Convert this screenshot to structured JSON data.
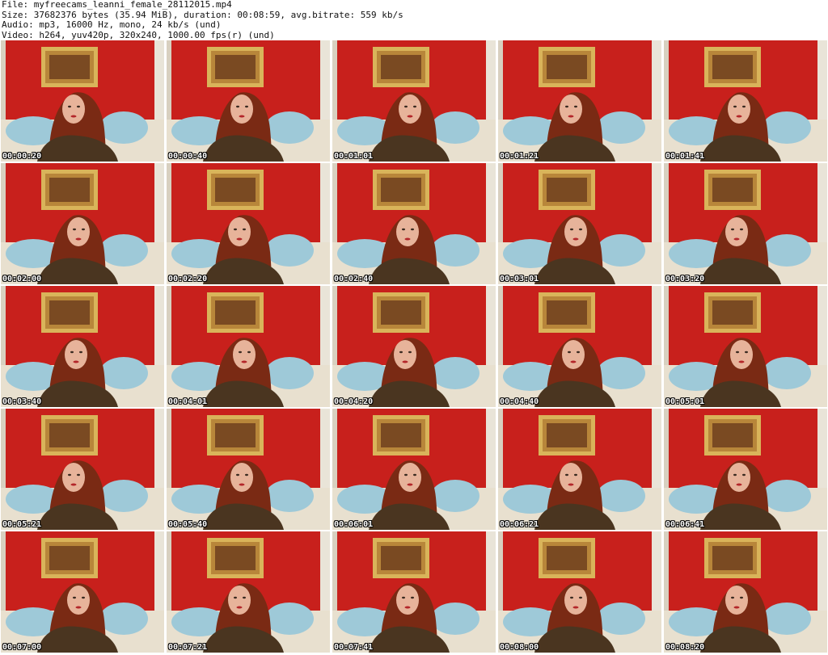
{
  "header": {
    "file_line": "File: myfreecams_leanni_female_28112015.mp4",
    "size_line": "Size: 37682376 bytes (35.94 MiB), duration: 00:08:59, avg.bitrate: 559 kb/s",
    "audio_line": "Audio: mp3, 16000 Hz, mono, 24 kb/s (und)",
    "video_line": "Video: h264, yuv420p, 320x240, 1000.00 fps(r) (und)"
  },
  "colors": {
    "wall": "#c8201c",
    "frame": "#d9b45a",
    "hair": "#7a2a14",
    "skin": "#e7b39a",
    "pillow": "#9ec9d8",
    "headboard": "#e8e0cf",
    "dress": "#4a3520"
  },
  "thumbnails": [
    {
      "timestamp": "00:00:20"
    },
    {
      "timestamp": "00:00:40"
    },
    {
      "timestamp": "00:01:01"
    },
    {
      "timestamp": "00:01:21"
    },
    {
      "timestamp": "00:01:41"
    },
    {
      "timestamp": "00:02:00"
    },
    {
      "timestamp": "00:02:20"
    },
    {
      "timestamp": "00:02:40"
    },
    {
      "timestamp": "00:03:01"
    },
    {
      "timestamp": "00:03:20"
    },
    {
      "timestamp": "00:03:40"
    },
    {
      "timestamp": "00:04:01"
    },
    {
      "timestamp": "00:04:20"
    },
    {
      "timestamp": "00:04:40"
    },
    {
      "timestamp": "00:05:01"
    },
    {
      "timestamp": "00:05:21"
    },
    {
      "timestamp": "00:05:40"
    },
    {
      "timestamp": "00:06:01"
    },
    {
      "timestamp": "00:06:21"
    },
    {
      "timestamp": "00:06:41"
    },
    {
      "timestamp": "00:07:00"
    },
    {
      "timestamp": "00:07:21"
    },
    {
      "timestamp": "00:07:41"
    },
    {
      "timestamp": "00:08:00"
    },
    {
      "timestamp": "00:08:20"
    }
  ]
}
